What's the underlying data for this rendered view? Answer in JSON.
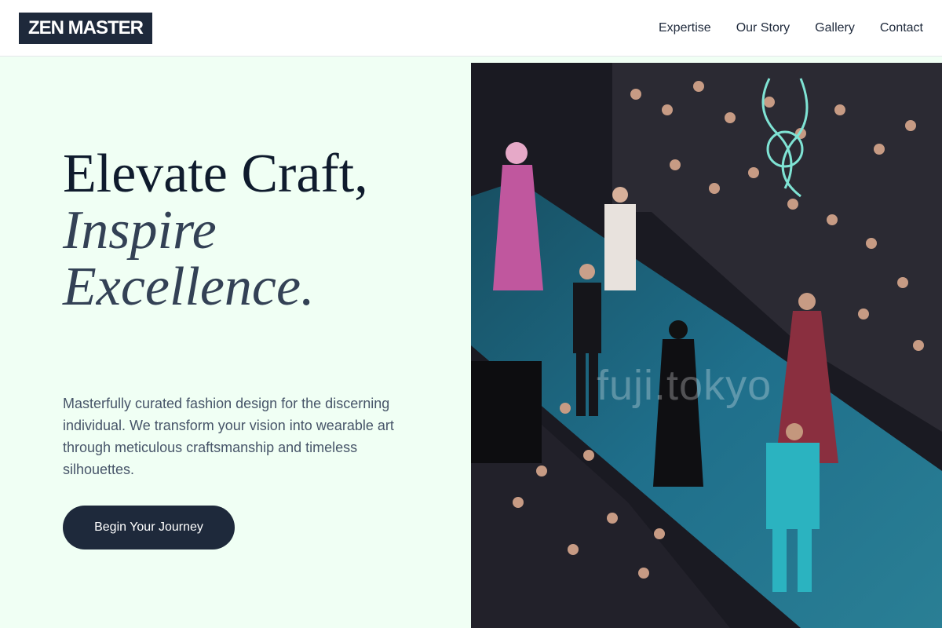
{
  "header": {
    "logo": "ZEN MASTER",
    "nav": [
      "Expertise",
      "Our Story",
      "Gallery",
      "Contact"
    ]
  },
  "hero": {
    "headline_line1": "Elevate Craft,",
    "headline_line2": "Inspire",
    "headline_line3": "Excellence.",
    "description": "Masterfully curated fashion design for the discerning individual. We transform your vision into wearable art through meticulous craftsmanship and timeless silhouettes.",
    "cta_label": "Begin Your Journey"
  },
  "image": {
    "watermark": "fuji.tokyo"
  },
  "colors": {
    "background": "#f0fff4",
    "primary": "#1e293b",
    "runway": "#1f6f8b"
  }
}
